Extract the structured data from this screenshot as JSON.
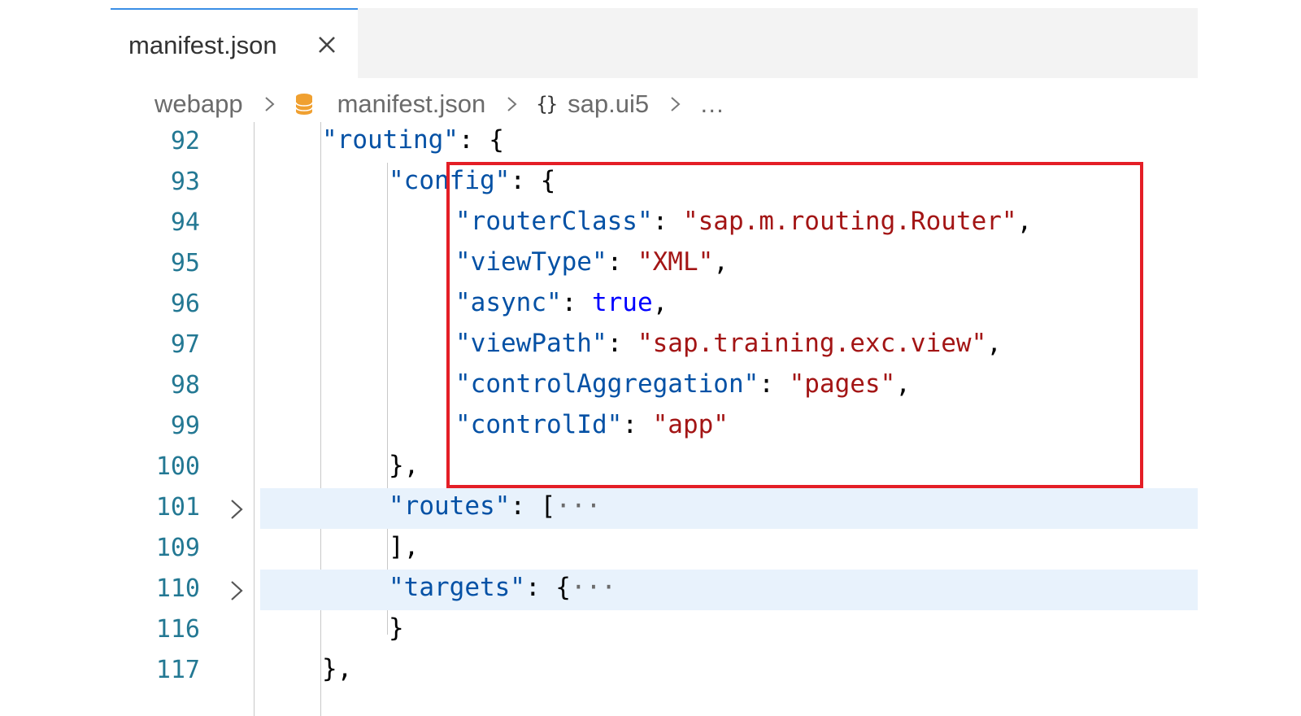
{
  "tab": {
    "label": "manifest.json",
    "close_icon": "close-icon"
  },
  "breadcrumb": {
    "items": [
      "webapp",
      "manifest.json",
      "sap.ui5",
      "…"
    ],
    "icons": {
      "file": "json-file-icon",
      "object": "braces-icon"
    }
  },
  "colors": {
    "key": "#0451a5",
    "string": "#a31515",
    "keyword": "#0000ff",
    "line_number": "#237893",
    "highlight_box": "#e41e26"
  },
  "lines": [
    {
      "num": "92",
      "indent": 1,
      "fold": false,
      "tokens": [
        {
          "t": "k",
          "v": "\"routing\""
        },
        {
          "t": "p",
          "v": ": {"
        }
      ]
    },
    {
      "num": "93",
      "indent": 2,
      "fold": false,
      "tokens": [
        {
          "t": "k",
          "v": "\"config\""
        },
        {
          "t": "p",
          "v": ": {"
        }
      ]
    },
    {
      "num": "94",
      "indent": 3,
      "fold": false,
      "tokens": [
        {
          "t": "k",
          "v": "\"routerClass\""
        },
        {
          "t": "p",
          "v": ": "
        },
        {
          "t": "s",
          "v": "\"sap.m.routing.Router\""
        },
        {
          "t": "p",
          "v": ","
        }
      ]
    },
    {
      "num": "95",
      "indent": 3,
      "fold": false,
      "tokens": [
        {
          "t": "k",
          "v": "\"viewType\""
        },
        {
          "t": "p",
          "v": ": "
        },
        {
          "t": "s",
          "v": "\"XML\""
        },
        {
          "t": "p",
          "v": ","
        }
      ]
    },
    {
      "num": "96",
      "indent": 3,
      "fold": false,
      "tokens": [
        {
          "t": "k",
          "v": "\"async\""
        },
        {
          "t": "p",
          "v": ": "
        },
        {
          "t": "b",
          "v": "true"
        },
        {
          "t": "p",
          "v": ","
        }
      ]
    },
    {
      "num": "97",
      "indent": 3,
      "fold": false,
      "tokens": [
        {
          "t": "k",
          "v": "\"viewPath\""
        },
        {
          "t": "p",
          "v": ": "
        },
        {
          "t": "s",
          "v": "\"sap.training.exc.view\""
        },
        {
          "t": "p",
          "v": ","
        }
      ]
    },
    {
      "num": "98",
      "indent": 3,
      "fold": false,
      "tokens": [
        {
          "t": "k",
          "v": "\"controlAggregation\""
        },
        {
          "t": "p",
          "v": ": "
        },
        {
          "t": "s",
          "v": "\"pages\""
        },
        {
          "t": "p",
          "v": ","
        }
      ]
    },
    {
      "num": "99",
      "indent": 3,
      "fold": false,
      "tokens": [
        {
          "t": "k",
          "v": "\"controlId\""
        },
        {
          "t": "p",
          "v": ": "
        },
        {
          "t": "s",
          "v": "\"app\""
        }
      ]
    },
    {
      "num": "100",
      "indent": 2,
      "fold": false,
      "tokens": [
        {
          "t": "p",
          "v": "},"
        }
      ]
    },
    {
      "num": "101",
      "indent": 2,
      "fold": true,
      "tokens": [
        {
          "t": "k",
          "v": "\"routes\""
        },
        {
          "t": "p",
          "v": ": ["
        },
        {
          "t": "d",
          "v": "···"
        }
      ]
    },
    {
      "num": "109",
      "indent": 2,
      "fold": false,
      "tokens": [
        {
          "t": "p",
          "v": "],"
        }
      ]
    },
    {
      "num": "110",
      "indent": 2,
      "fold": true,
      "tokens": [
        {
          "t": "k",
          "v": "\"targets\""
        },
        {
          "t": "p",
          "v": ": {"
        },
        {
          "t": "d",
          "v": "···"
        }
      ]
    },
    {
      "num": "116",
      "indent": 2,
      "fold": false,
      "tokens": [
        {
          "t": "p",
          "v": "}"
        }
      ]
    },
    {
      "num": "117",
      "indent": 1,
      "fold": false,
      "tokens": [
        {
          "t": "p",
          "v": "},"
        }
      ]
    }
  ]
}
